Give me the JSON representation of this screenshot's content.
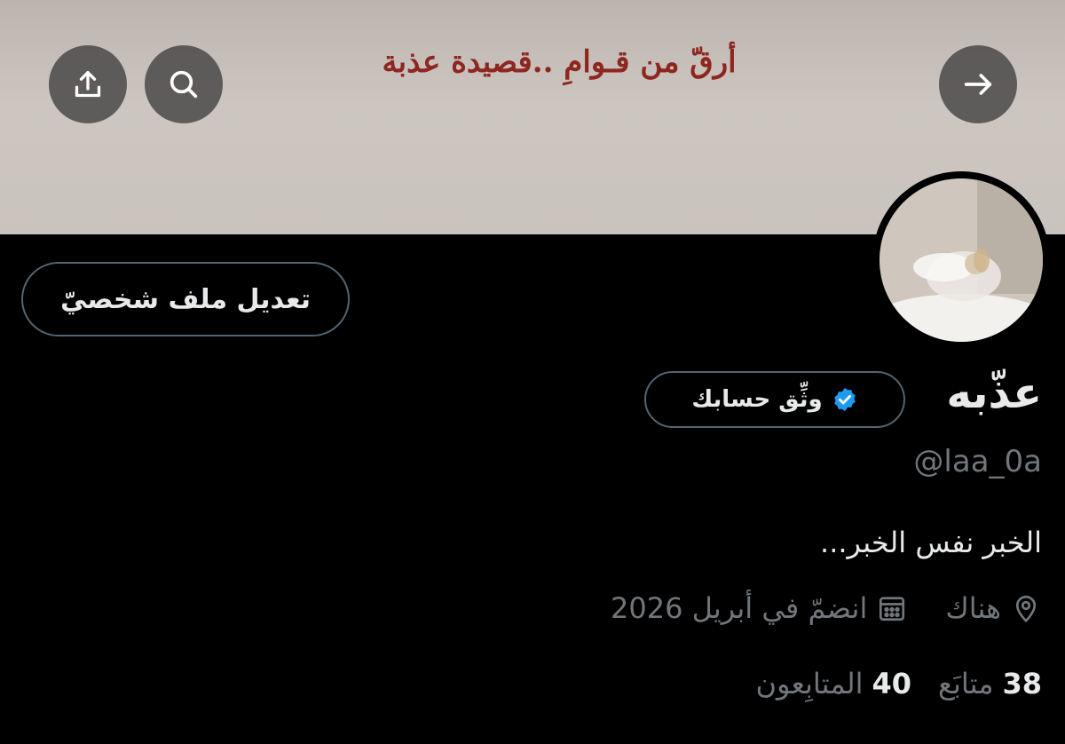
{
  "banner": {
    "text": "أرقّ من قـوامِ ..قصيدة عذبة"
  },
  "profile": {
    "display_name": "عذّبه",
    "handle": "@laa_0a",
    "bio": "الخبر نفس الخبر...",
    "location": "هناك",
    "joined": "انضمّ في أبريل 2026",
    "following_count": "38",
    "following_label": "متابَع",
    "followers_count": "40",
    "followers_label": "المتابِعون"
  },
  "buttons": {
    "edit_profile": "تعديل ملف شخصيّ",
    "verify": "وثِّق حسابك"
  },
  "icons": {
    "back": "arrow-right-icon",
    "search": "search-icon",
    "share": "share-upload-icon",
    "verified": "verified-badge-icon",
    "location": "location-pin-icon",
    "calendar": "calendar-icon"
  },
  "colors": {
    "background": "#000000",
    "primary_text": "#e7e9ea",
    "secondary_text": "#71767b",
    "verified_blue": "#1d9bf0",
    "banner_text": "#8e2620"
  }
}
